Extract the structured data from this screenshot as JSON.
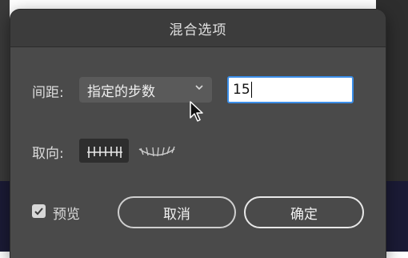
{
  "dialog": {
    "title": "混合选项"
  },
  "spacing": {
    "label": "间距:",
    "selected": "指定的步数",
    "value": "15"
  },
  "orientation": {
    "label": "取向:",
    "options": [
      "align-to-page-icon",
      "align-to-path-icon"
    ],
    "selected_index": 0
  },
  "preview": {
    "label": "预览",
    "checked": true
  },
  "buttons": {
    "cancel": "取消",
    "ok": "确定"
  }
}
